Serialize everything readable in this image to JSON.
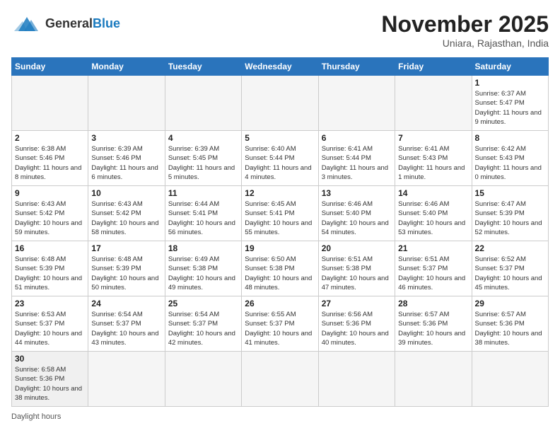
{
  "header": {
    "logo_general": "General",
    "logo_blue": "Blue",
    "month": "November 2025",
    "location": "Uniara, Rajasthan, India"
  },
  "days_of_week": [
    "Sunday",
    "Monday",
    "Tuesday",
    "Wednesday",
    "Thursday",
    "Friday",
    "Saturday"
  ],
  "weeks": [
    [
      {
        "day": null,
        "sunrise": null,
        "sunset": null,
        "daylight": null
      },
      {
        "day": null,
        "sunrise": null,
        "sunset": null,
        "daylight": null
      },
      {
        "day": null,
        "sunrise": null,
        "sunset": null,
        "daylight": null
      },
      {
        "day": null,
        "sunrise": null,
        "sunset": null,
        "daylight": null
      },
      {
        "day": null,
        "sunrise": null,
        "sunset": null,
        "daylight": null
      },
      {
        "day": null,
        "sunrise": null,
        "sunset": null,
        "daylight": null
      },
      {
        "day": "1",
        "sunrise": "6:37 AM",
        "sunset": "5:47 PM",
        "daylight": "11 hours and 9 minutes."
      }
    ],
    [
      {
        "day": "2",
        "sunrise": "6:38 AM",
        "sunset": "5:46 PM",
        "daylight": "11 hours and 8 minutes."
      },
      {
        "day": "3",
        "sunrise": "6:39 AM",
        "sunset": "5:46 PM",
        "daylight": "11 hours and 6 minutes."
      },
      {
        "day": "4",
        "sunrise": "6:39 AM",
        "sunset": "5:45 PM",
        "daylight": "11 hours and 5 minutes."
      },
      {
        "day": "5",
        "sunrise": "6:40 AM",
        "sunset": "5:44 PM",
        "daylight": "11 hours and 4 minutes."
      },
      {
        "day": "6",
        "sunrise": "6:41 AM",
        "sunset": "5:44 PM",
        "daylight": "11 hours and 3 minutes."
      },
      {
        "day": "7",
        "sunrise": "6:41 AM",
        "sunset": "5:43 PM",
        "daylight": "11 hours and 1 minute."
      },
      {
        "day": "8",
        "sunrise": "6:42 AM",
        "sunset": "5:43 PM",
        "daylight": "11 hours and 0 minutes."
      }
    ],
    [
      {
        "day": "9",
        "sunrise": "6:43 AM",
        "sunset": "5:42 PM",
        "daylight": "10 hours and 59 minutes."
      },
      {
        "day": "10",
        "sunrise": "6:43 AM",
        "sunset": "5:42 PM",
        "daylight": "10 hours and 58 minutes."
      },
      {
        "day": "11",
        "sunrise": "6:44 AM",
        "sunset": "5:41 PM",
        "daylight": "10 hours and 56 minutes."
      },
      {
        "day": "12",
        "sunrise": "6:45 AM",
        "sunset": "5:41 PM",
        "daylight": "10 hours and 55 minutes."
      },
      {
        "day": "13",
        "sunrise": "6:46 AM",
        "sunset": "5:40 PM",
        "daylight": "10 hours and 54 minutes."
      },
      {
        "day": "14",
        "sunrise": "6:46 AM",
        "sunset": "5:40 PM",
        "daylight": "10 hours and 53 minutes."
      },
      {
        "day": "15",
        "sunrise": "6:47 AM",
        "sunset": "5:39 PM",
        "daylight": "10 hours and 52 minutes."
      }
    ],
    [
      {
        "day": "16",
        "sunrise": "6:48 AM",
        "sunset": "5:39 PM",
        "daylight": "10 hours and 51 minutes."
      },
      {
        "day": "17",
        "sunrise": "6:48 AM",
        "sunset": "5:39 PM",
        "daylight": "10 hours and 50 minutes."
      },
      {
        "day": "18",
        "sunrise": "6:49 AM",
        "sunset": "5:38 PM",
        "daylight": "10 hours and 49 minutes."
      },
      {
        "day": "19",
        "sunrise": "6:50 AM",
        "sunset": "5:38 PM",
        "daylight": "10 hours and 48 minutes."
      },
      {
        "day": "20",
        "sunrise": "6:51 AM",
        "sunset": "5:38 PM",
        "daylight": "10 hours and 47 minutes."
      },
      {
        "day": "21",
        "sunrise": "6:51 AM",
        "sunset": "5:37 PM",
        "daylight": "10 hours and 46 minutes."
      },
      {
        "day": "22",
        "sunrise": "6:52 AM",
        "sunset": "5:37 PM",
        "daylight": "10 hours and 45 minutes."
      }
    ],
    [
      {
        "day": "23",
        "sunrise": "6:53 AM",
        "sunset": "5:37 PM",
        "daylight": "10 hours and 44 minutes."
      },
      {
        "day": "24",
        "sunrise": "6:54 AM",
        "sunset": "5:37 PM",
        "daylight": "10 hours and 43 minutes."
      },
      {
        "day": "25",
        "sunrise": "6:54 AM",
        "sunset": "5:37 PM",
        "daylight": "10 hours and 42 minutes."
      },
      {
        "day": "26",
        "sunrise": "6:55 AM",
        "sunset": "5:37 PM",
        "daylight": "10 hours and 41 minutes."
      },
      {
        "day": "27",
        "sunrise": "6:56 AM",
        "sunset": "5:36 PM",
        "daylight": "10 hours and 40 minutes."
      },
      {
        "day": "28",
        "sunrise": "6:57 AM",
        "sunset": "5:36 PM",
        "daylight": "10 hours and 39 minutes."
      },
      {
        "day": "29",
        "sunrise": "6:57 AM",
        "sunset": "5:36 PM",
        "daylight": "10 hours and 38 minutes."
      }
    ],
    [
      {
        "day": "30",
        "sunrise": "6:58 AM",
        "sunset": "5:36 PM",
        "daylight": "10 hours and 38 minutes."
      },
      {
        "day": null,
        "sunrise": null,
        "sunset": null,
        "daylight": null
      },
      {
        "day": null,
        "sunrise": null,
        "sunset": null,
        "daylight": null
      },
      {
        "day": null,
        "sunrise": null,
        "sunset": null,
        "daylight": null
      },
      {
        "day": null,
        "sunrise": null,
        "sunset": null,
        "daylight": null
      },
      {
        "day": null,
        "sunrise": null,
        "sunset": null,
        "daylight": null
      },
      {
        "day": null,
        "sunrise": null,
        "sunset": null,
        "daylight": null
      }
    ]
  ],
  "footer": {
    "note": "Daylight hours"
  }
}
